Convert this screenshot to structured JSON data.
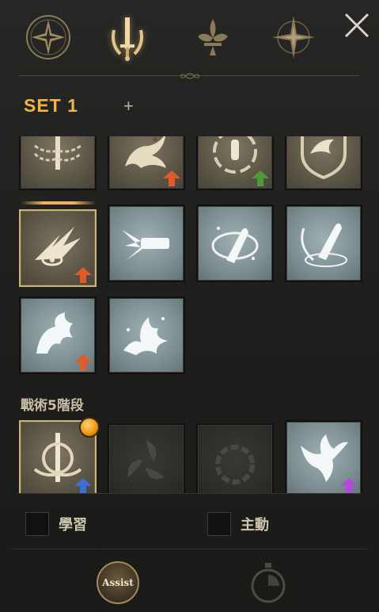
{
  "tabs": [
    {
      "id": "compass-star",
      "icon": "star-compass-icon"
    },
    {
      "id": "sword-laurel",
      "icon": "sword-laurel-icon",
      "active": true
    },
    {
      "id": "fleur",
      "icon": "fleur-de-lis-icon"
    },
    {
      "id": "compass-rose",
      "icon": "compass-rose-icon"
    }
  ],
  "set": {
    "label": "SET 1",
    "add_symbol": "+"
  },
  "skills": {
    "row1": [
      {
        "icon": "chained-sword-icon",
        "style": "bronze"
      },
      {
        "icon": "dragon-icon",
        "style": "bronze",
        "upgrade": "orange"
      },
      {
        "icon": "bullet-vortex-icon",
        "style": "bronze",
        "upgrade": "green"
      },
      {
        "icon": "eagle-shield-icon",
        "style": "bronze"
      }
    ],
    "row2": [
      {
        "icon": "eye-slash-icon",
        "style": "bronze",
        "upgrade": "orange",
        "equipped": true
      },
      {
        "icon": "gun-burst-icon",
        "style": "steel"
      },
      {
        "icon": "bullet-orbit-icon",
        "style": "steel"
      },
      {
        "icon": "bullet-laurel-icon",
        "style": "steel"
      }
    ],
    "row3": [
      {
        "icon": "winged-beast-icon",
        "style": "steel",
        "upgrade": "orange"
      },
      {
        "icon": "phoenix-flame-icon",
        "style": "steel"
      }
    ]
  },
  "tactics": {
    "label": "戰術5階段",
    "slots": [
      {
        "icon": "sword-crest-icon",
        "style": "bronze",
        "notify": true,
        "upgrade": "blue"
      },
      {
        "icon": "triple-swirl-icon",
        "style": "dark"
      },
      {
        "icon": "fire-ring-icon",
        "style": "dark"
      },
      {
        "icon": "phoenix-icon",
        "style": "steel",
        "upgrade": "purple"
      }
    ]
  },
  "options": {
    "learn_label": "學習",
    "active_label": "主動"
  },
  "footer": {
    "assist_label": "Assist"
  },
  "colors": {
    "accent": "#f2b544",
    "upgrade_orange": "#e05a2a",
    "upgrade_green": "#4e9a3a",
    "upgrade_blue": "#3d6fd4",
    "upgrade_purple": "#b04bd6"
  }
}
